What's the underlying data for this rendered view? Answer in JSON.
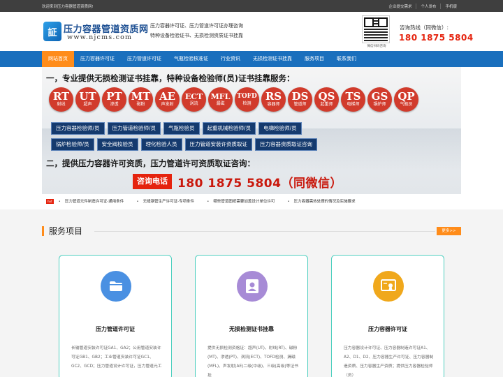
{
  "topbar": {
    "welcome": "欢迎来到压力容器管道资质网!",
    "links": [
      "企业提交需求",
      "个人发布",
      "手机版"
    ]
  },
  "header": {
    "logo_glyph": "証",
    "brand_title": "压力容器管道资质网",
    "brand_url": "www.njcms.com",
    "slogan_line1": "压力容器许可证、压力管道许可证办理咨询",
    "slogan_line2": "特种设备检验证书、无损检测资质证书挂靠",
    "qr_caption": "微信扫码咨询",
    "hotline_label": "咨询热线（同微信）:",
    "hotline_number": "180 1875 5804"
  },
  "nav": {
    "items": [
      "网站首页",
      "压力容器许可证",
      "压力管道许可证",
      "气瓶检验核准证",
      "行业资讯",
      "无损检测证书挂靠",
      "服务项目",
      "联系我们"
    ],
    "active_index": 0
  },
  "banner": {
    "heading1": "一，专业提供无损检测证书挂靠，特种设备检验师(员)证书挂靠服务：",
    "circles": [
      {
        "abbr": "RT",
        "cn": "射线"
      },
      {
        "abbr": "UT",
        "cn": "超声"
      },
      {
        "abbr": "PT",
        "cn": "渗透"
      },
      {
        "abbr": "MT",
        "cn": "磁粉"
      },
      {
        "abbr": "AE",
        "cn": "声发射"
      },
      {
        "abbr": "ECT",
        "cn": "涡流"
      },
      {
        "abbr": "MFL",
        "cn": "漏磁"
      },
      {
        "abbr": "TOFD",
        "cn": "检测"
      },
      {
        "abbr": "RS",
        "cn": "容器师"
      },
      {
        "abbr": "DS",
        "cn": "管道师"
      },
      {
        "abbr": "QS",
        "cn": "起重师"
      },
      {
        "abbr": "TS",
        "cn": "电梯师"
      },
      {
        "abbr": "GS",
        "cn": "锅炉师"
      },
      {
        "abbr": "QP",
        "cn": "气瓶员"
      }
    ],
    "tags_row1": [
      "压力容器检验师/员",
      "压力管道检验师/员",
      "气瓶检验员",
      "起重机械检验师/员",
      "电梯检验师/员"
    ],
    "tags_row2": [
      "锅炉检验师/员",
      "安全阀校验员",
      "理化检验人员",
      "压力管道安装许资质取证",
      "压力容器资质取证咨询"
    ],
    "heading2": "二，提供压力容器许可资质，压力管道许可资质取证咨询：",
    "consult_label": "咨询电话",
    "consult_number": "180 1875 5804（同微信）"
  },
  "ticker": {
    "badge": "hot",
    "items": [
      "压力管道元件制造许可证-通用条件",
      "无缝钢管生产许可证-专项条件",
      "哪些管道图纸需要加盖设计单位许可",
      "压力容器需热处理的情况及实施要求"
    ]
  },
  "services": {
    "title": "服务项目",
    "more_label": "更多>>",
    "cards": [
      {
        "icon": "folder-icon",
        "icon_bg": "#4a90e2",
        "title": "压力管道许可证",
        "desc": "长输管道安装许可证GA1、GA2；公用管道安装许可证GB1、GB2；工业管道安装许可证GC1、GC2、GCD；压力管道设计许可证，压力管道元工"
      },
      {
        "icon": "user-icon",
        "icon_bg": "#a78bd6",
        "title": "无损检测证书挂靠",
        "desc": "提供无损检测资格证：超声(UT)、射线(RT)、磁粉(MT)、渗透(PT)、涡流(ECT)、TOFD检测、漏磁(MFL)、声发射(AE)二级(中级)、三级(高级)等证书挂"
      },
      {
        "icon": "certificate-icon",
        "icon_bg": "#f0a81c",
        "title": "压力容器许可证",
        "desc": "压力容器设计许可证、压力容器制造许可证A1、A2、D1、D2、压力容器生产许可证、压力容器制造资质、压力容器生产资质；提供压力容器检验师（员）"
      }
    ]
  }
}
